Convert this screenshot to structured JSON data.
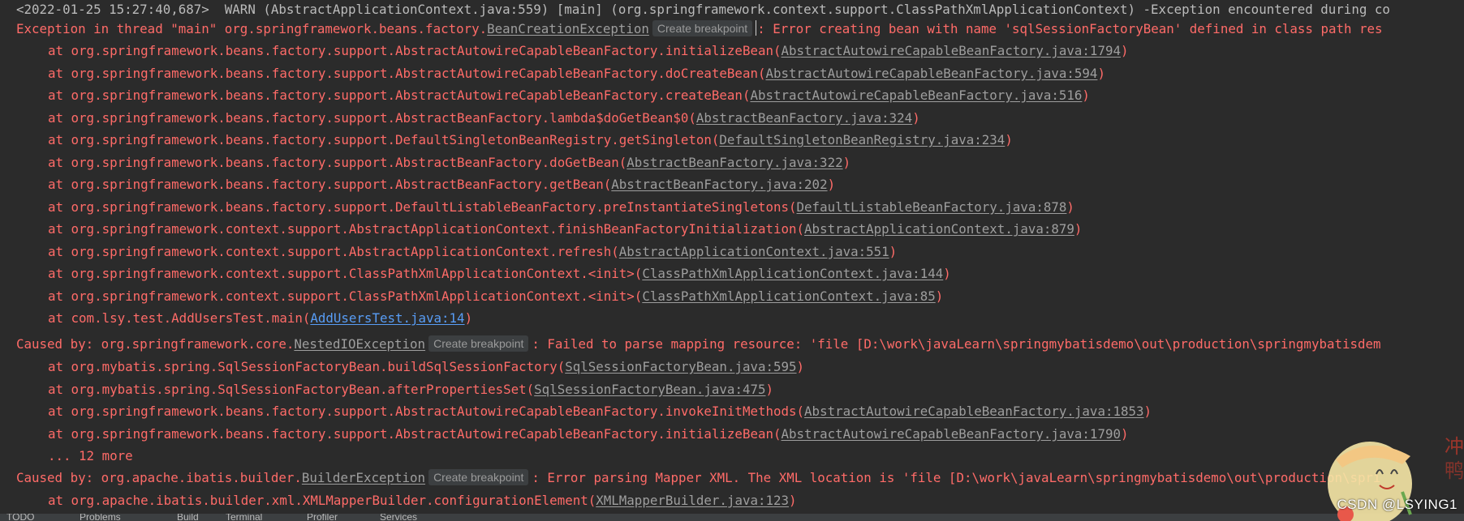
{
  "console": {
    "warn_line": "<2022-01-25 15:27:40,687>  WARN (AbstractApplicationContext.java:559) [main] (org.springframework.context.support.ClassPathXmlApplicationContext) -Exception encountered during co",
    "breakpoint_label": "Create breakpoint",
    "ex1": {
      "prefix": "Exception in thread \"main\" org.springframework.beans.factory.",
      "class_link": "BeanCreationException",
      "message": ": Error creating bean with name 'sqlSessionFactoryBean' defined in class path res"
    },
    "trace1": [
      {
        "method": "at org.springframework.beans.factory.support.AbstractAutowireCapableBeanFactory.initializeBean(",
        "link": "AbstractAutowireCapableBeanFactory.java:1794"
      },
      {
        "method": "at org.springframework.beans.factory.support.AbstractAutowireCapableBeanFactory.doCreateBean(",
        "link": "AbstractAutowireCapableBeanFactory.java:594"
      },
      {
        "method": "at org.springframework.beans.factory.support.AbstractAutowireCapableBeanFactory.createBean(",
        "link": "AbstractAutowireCapableBeanFactory.java:516"
      },
      {
        "method": "at org.springframework.beans.factory.support.AbstractBeanFactory.lambda$doGetBean$0(",
        "link": "AbstractBeanFactory.java:324"
      },
      {
        "method": "at org.springframework.beans.factory.support.DefaultSingletonBeanRegistry.getSingleton(",
        "link": "DefaultSingletonBeanRegistry.java:234"
      },
      {
        "method": "at org.springframework.beans.factory.support.AbstractBeanFactory.doGetBean(",
        "link": "AbstractBeanFactory.java:322"
      },
      {
        "method": "at org.springframework.beans.factory.support.AbstractBeanFactory.getBean(",
        "link": "AbstractBeanFactory.java:202"
      },
      {
        "method": "at org.springframework.beans.factory.support.DefaultListableBeanFactory.preInstantiateSingletons(",
        "link": "DefaultListableBeanFactory.java:878"
      },
      {
        "method": "at org.springframework.context.support.AbstractApplicationContext.finishBeanFactoryInitialization(",
        "link": "AbstractApplicationContext.java:879"
      },
      {
        "method": "at org.springframework.context.support.AbstractApplicationContext.refresh(",
        "link": "AbstractApplicationContext.java:551"
      },
      {
        "method": "at org.springframework.context.support.ClassPathXmlApplicationContext.<init>(",
        "link": "ClassPathXmlApplicationContext.java:144"
      },
      {
        "method": "at org.springframework.context.support.ClassPathXmlApplicationContext.<init>(",
        "link": "ClassPathXmlApplicationContext.java:85"
      },
      {
        "method": "at com.lsy.test.AddUsersTest.main(",
        "link": "AddUsersTest.java:14"
      }
    ],
    "cause1": {
      "prefix": "Caused by: org.springframework.core.",
      "class_link": "NestedIOException",
      "message": ": Failed to parse mapping resource: 'file [D:\\work\\javaLearn\\springmybatisdemo\\out\\production\\springmybatisdem"
    },
    "trace2": [
      {
        "method": "at org.mybatis.spring.SqlSessionFactoryBean.buildSqlSessionFactory(",
        "link": "SqlSessionFactoryBean.java:595"
      },
      {
        "method": "at org.mybatis.spring.SqlSessionFactoryBean.afterPropertiesSet(",
        "link": "SqlSessionFactoryBean.java:475"
      },
      {
        "method": "at org.springframework.beans.factory.support.AbstractAutowireCapableBeanFactory.invokeInitMethods(",
        "link": "AbstractAutowireCapableBeanFactory.java:1853"
      },
      {
        "method": "at org.springframework.beans.factory.support.AbstractAutowireCapableBeanFactory.initializeBean(",
        "link": "AbstractAutowireCapableBeanFactory.java:1790"
      }
    ],
    "more": "... 12 more",
    "cause2": {
      "prefix": "Caused by: org.apache.ibatis.builder.",
      "class_link": "BuilderException",
      "message": ": Error parsing Mapper XML. The XML location is 'file [D:\\work\\javaLearn\\springmybatisdemo\\out\\production\\spri"
    },
    "trace3": [
      {
        "method": "at org.apache.ibatis.builder.xml.XMLMapperBuilder.configurationElement(",
        "link": "XMLMapperBuilder.java:123"
      }
    ],
    "close_paren": ")"
  },
  "statusbar": {
    "items": [
      "TODO",
      "Problems",
      "Build",
      "Terminal",
      "Profiler",
      "Services"
    ]
  },
  "watermark": {
    "text": "CSDN @LSYING1"
  },
  "colors": {
    "background": "#2b2b2b",
    "error_text": "#ff6b68",
    "warn_text": "#bbbbbb",
    "file_link": "#9e9e9e",
    "project_link": "#589df6"
  }
}
